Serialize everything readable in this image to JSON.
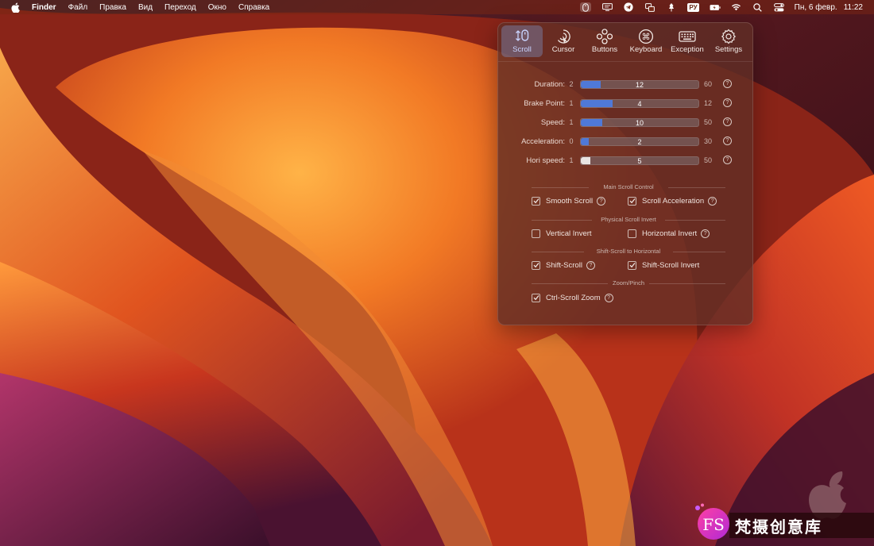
{
  "menubar": {
    "apple_icon": "apple-logo-icon",
    "items": [
      "Finder",
      "Файл",
      "Правка",
      "Вид",
      "Переход",
      "Окно",
      "Справка"
    ],
    "status_icons": [
      "mouse-icon",
      "display-icon",
      "telegram-icon",
      "screens-icon",
      "pin-icon"
    ],
    "input_source": "РУ",
    "battery_icon": "battery-icon",
    "wifi_icon": "wifi-icon",
    "search_icon": "search-icon",
    "control_center_icon": "control-center-icon",
    "date": "Пн, 6 февр.",
    "time": "11:22"
  },
  "panel": {
    "tabs": [
      {
        "label": "Scroll",
        "icon": "scroll-icon",
        "active": true
      },
      {
        "label": "Cursor",
        "icon": "cursor-icon",
        "active": false
      },
      {
        "label": "Buttons",
        "icon": "buttons-icon",
        "active": false
      },
      {
        "label": "Keyboard",
        "icon": "command-key-icon",
        "active": false
      },
      {
        "label": "Exception",
        "icon": "keyboard-icon",
        "active": false
      },
      {
        "label": "Settings",
        "icon": "gear-icon",
        "active": false
      }
    ],
    "sliders": [
      {
        "label": "Duration:",
        "min": "2",
        "value": "12",
        "max": "60",
        "fill": 0.17
      },
      {
        "label": "Brake Point:",
        "min": "1",
        "value": "4",
        "max": "12",
        "fill": 0.27
      },
      {
        "label": "Speed:",
        "min": "1",
        "value": "10",
        "max": "50",
        "fill": 0.18
      },
      {
        "label": "Acceleration:",
        "min": "0",
        "value": "2",
        "max": "30",
        "fill": 0.07
      },
      {
        "label": "Hori speed:",
        "min": "1",
        "value": "5",
        "max": "50",
        "fill": 0.08
      }
    ],
    "help_glyph": "?",
    "sections": [
      {
        "title": "Main Scroll Control",
        "options": [
          {
            "label": "Smooth Scroll",
            "checked": true,
            "help": true
          },
          {
            "label": "Scroll Acceleration",
            "checked": true,
            "help": true
          }
        ]
      },
      {
        "title": "Physical Scroll Invert",
        "options": [
          {
            "label": "Vertical Invert",
            "checked": false,
            "help": false
          },
          {
            "label": "Horizontal Invert",
            "checked": false,
            "help": true
          }
        ]
      },
      {
        "title": "Shift-Scroll to Horizontal",
        "options": [
          {
            "label": "Shift-Scroll",
            "checked": true,
            "help": true
          },
          {
            "label": "Shift-Scroll Invert",
            "checked": true,
            "help": false
          }
        ]
      },
      {
        "title": "Zoom/Pinch",
        "options": [
          {
            "label": "Ctrl-Scroll Zoom",
            "checked": true,
            "help": true
          }
        ]
      }
    ]
  },
  "watermark": {
    "text": "梵摄创意库",
    "logo_text": "FS"
  },
  "colors": {
    "accent": "#4f79d8",
    "panel_bg": "#602e26",
    "active_tab": "#7d87b4"
  }
}
